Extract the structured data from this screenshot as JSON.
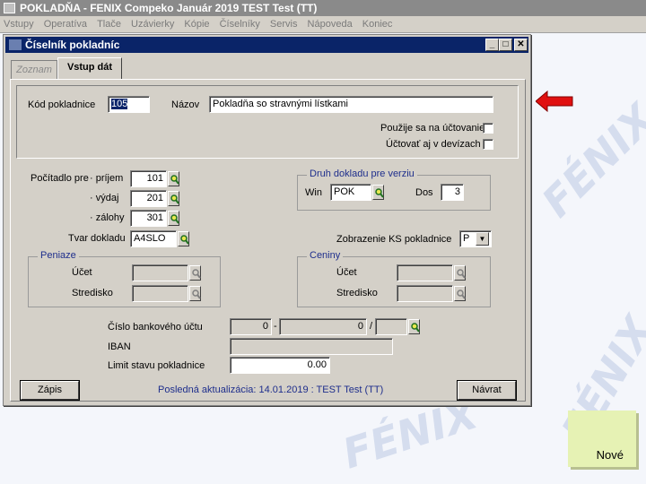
{
  "app": {
    "title": "POKLADŇA - FENIX Compeko   Január 2019   TEST Test  (TT)",
    "menu": [
      "Vstupy",
      "Operatíva",
      "Tlače",
      "Uzávierky",
      "Kópie",
      "Číselníky",
      "Servis",
      "Nápoveda",
      "Koniec"
    ],
    "watermark": "FÉNIX"
  },
  "window": {
    "title": "Číselník pokladníc",
    "controls": [
      "_",
      "□",
      "✕"
    ],
    "tabs": [
      {
        "label": "Zoznam",
        "active": false
      },
      {
        "label": "Vstup dát",
        "active": true
      }
    ]
  },
  "form": {
    "kod_label": "Kód pokladnice",
    "kod_value": "105",
    "nazov_label": "Názov",
    "nazov_value": "Pokladňa so stravnými lístkami",
    "uctovanie_label": "Použije sa na účtovanie",
    "devizy_label": "Účtovať aj v devízach",
    "uctovanie_checked": false,
    "devizy_checked": false,
    "pocitadlo_label": "Počítadlo pre",
    "prijem_label": "·  príjem",
    "prijem_value": "101",
    "vydaj_label": "·  výdaj",
    "vydaj_value": "201",
    "zalohy_label": "·  zálohy",
    "zalohy_value": "301",
    "tvar_label": "Tvar dokladu",
    "tvar_value": "A4SLO",
    "druh_legend": "Druh dokladu pre verziu",
    "win_label": "Win",
    "win_value": "POK",
    "dos_label": "Dos",
    "dos_value": "3",
    "zobrazenie_label": "Zobrazenie KS pokladnice",
    "zobrazenie_value": "P",
    "peniaze_legend": "Peniaze",
    "peniaze_ucet_label": "Účet",
    "peniaze_stredisko_label": "Stredisko",
    "ceniny_legend": "Ceniny",
    "ceniny_ucet_label": "Účet",
    "ceniny_stredisko_label": "Stredisko",
    "bank_label": "Číslo bankového účtu",
    "bank_prefix": "0",
    "bank_sep1": "-",
    "bank_number": "0",
    "bank_sep2": "/",
    "iban_label": "IBAN",
    "limit_label": "Limit stavu pokladnice",
    "limit_value": "0.00"
  },
  "footer": {
    "zapis": "Zápis",
    "last_update": "Posledná aktualizácia: 14.01.2019 : TEST Test  (TT)",
    "navrat": "Návrat"
  },
  "note": {
    "label": "Nové"
  },
  "colors": {
    "title_active": "#0a2468",
    "label_blue": "#1e2e8c",
    "arrow": "#e01010",
    "note": "#e6f2b4"
  }
}
